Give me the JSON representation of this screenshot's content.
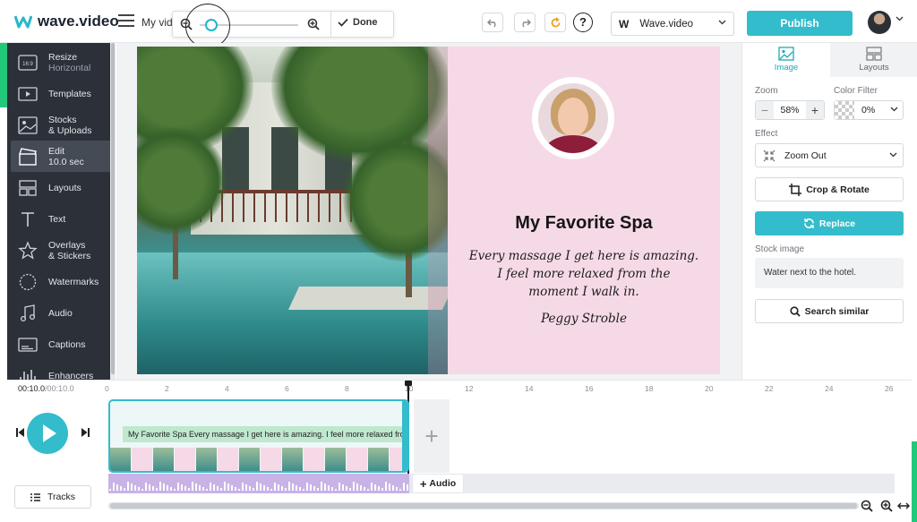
{
  "app": {
    "logo_text": "wave.video",
    "project_name": "My vide"
  },
  "zoom_toolbar": {
    "done_label": "Done",
    "slider_value": 0.1
  },
  "header": {
    "brand_name": "Wave.video",
    "brand_initial": "W",
    "publish_label": "Publish"
  },
  "sidebar": {
    "items": [
      {
        "icon": "resize-icon",
        "icon_text": "16:9",
        "label": "Resize",
        "sub": "Horizontal"
      },
      {
        "icon": "templates-icon",
        "label": "Templates",
        "sub": ""
      },
      {
        "icon": "stocks-icon",
        "label": "Stocks",
        "sub": "& Uploads"
      },
      {
        "icon": "edit-icon",
        "label": "Edit",
        "sub": "10.0 sec",
        "active": true
      },
      {
        "icon": "layouts-icon",
        "label": "Layouts",
        "sub": ""
      },
      {
        "icon": "text-icon",
        "label": "Text",
        "sub": ""
      },
      {
        "icon": "overlays-icon",
        "label": "Overlays",
        "sub": "& Stickers"
      },
      {
        "icon": "watermarks-icon",
        "label": "Watermarks",
        "sub": ""
      },
      {
        "icon": "audio-icon",
        "label": "Audio",
        "sub": ""
      },
      {
        "icon": "captions-icon",
        "label": "Captions",
        "sub": ""
      },
      {
        "icon": "enhancers-icon",
        "label": "Enhancers",
        "sub": ""
      }
    ]
  },
  "slide": {
    "title": "My Favorite Spa",
    "quote_lines": [
      "Every massage I get here is amazing.",
      "I feel more relaxed from the",
      "moment I walk in."
    ],
    "author": "Peggy Stroble",
    "background_color": "#f6d9e6"
  },
  "right_panel": {
    "tabs": [
      {
        "label": "Image",
        "active": true
      },
      {
        "label": "Layouts",
        "active": false
      }
    ],
    "zoom_label": "Zoom",
    "zoom_value": "58%",
    "color_filter_label": "Color Filter",
    "color_filter_value": "0%",
    "effect_label": "Effect",
    "effect_value": "Zoom Out",
    "crop_label": "Crop & Rotate",
    "replace_label": "Replace",
    "stock_image_label": "Stock image",
    "stock_image_desc": "Water next to the hotel.",
    "search_similar_label": "Search similar"
  },
  "timeline": {
    "current_time": "00:10.0",
    "total_time": "00:10.0",
    "ruler_ticks": [
      "0",
      "2",
      "4",
      "6",
      "8",
      "10",
      "12",
      "14",
      "16",
      "18",
      "20",
      "22",
      "24",
      "26"
    ],
    "clip_caption": "My Favorite Spa Every massage I get here is amazing. I feel more relaxed from the moment I walk in.",
    "add_audio_label": "Audio",
    "tracks_label": "Tracks"
  },
  "colors": {
    "accent": "#33bccb",
    "sidebar_bg": "#2b3039",
    "frame_green": "#22c97a"
  }
}
